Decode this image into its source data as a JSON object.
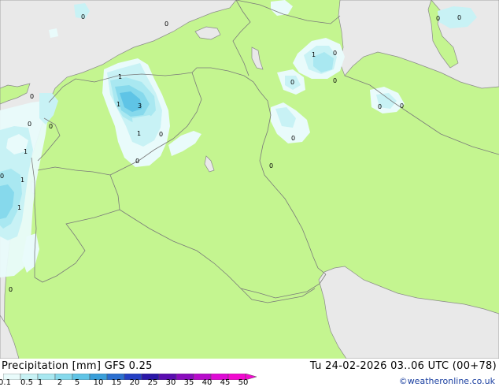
{
  "footer": {
    "title_left": "Precipitation [mm]  GFS 0.25",
    "title_right": "Tu 24-02-2026 03..06 UTC (00+78)",
    "credit": "©weatheronline.co.uk"
  },
  "legend": {
    "ticks": [
      "0.1",
      "0.5",
      "1",
      "2",
      "5",
      "10",
      "15",
      "20",
      "25",
      "30",
      "35",
      "40",
      "45",
      "50"
    ],
    "colors": [
      "#e9fbfb",
      "#c8f2f5",
      "#a9e8f1",
      "#86d9ec",
      "#5fc4e6",
      "#3a9fda",
      "#2a6fd0",
      "#243fc4",
      "#2a17a8",
      "#5a0cb0",
      "#8a0cbe",
      "#b80ccc",
      "#de0bd5",
      "#f20ad0"
    ]
  },
  "map": {
    "land_color": "#c4f590",
    "sea_color": "#e9e9e9",
    "border_color": "#7a7a7a",
    "value_labels": [
      "0",
      "0",
      "0",
      "0",
      "1",
      "1",
      "3",
      "1",
      "0",
      "0",
      "0",
      "0",
      "1",
      "0",
      "0",
      "0",
      "1",
      "0",
      "1",
      "1",
      "0",
      "0",
      "0",
      "0",
      "0",
      "0"
    ]
  }
}
